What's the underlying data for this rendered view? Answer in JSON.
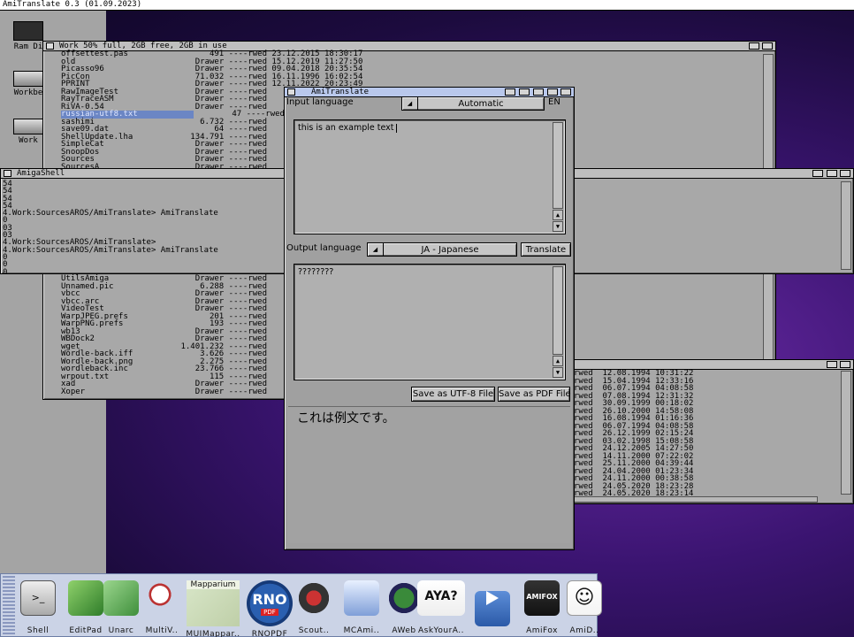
{
  "screen": {
    "title": "AmiTranslate 0.3 (01.09.2023)"
  },
  "desktop_icons": [
    "Ram Di",
    "Workbe",
    "Work"
  ],
  "work_window": {
    "title": "Work  50% full, 2GB free, 2GB in use",
    "files_top": [
      [
        "offsettest.pas",
        "491",
        "----rwed",
        "23.12.2015",
        "18:30:17"
      ],
      [
        "old",
        "Drawer",
        "----rwed",
        "15.12.2019",
        "11:27:50"
      ],
      [
        "Picasso96",
        "Drawer",
        "----rwed",
        "09.04.2018",
        "20:35:54"
      ],
      [
        "PicCon",
        "71.032",
        "----rwed",
        "16.11.1996",
        "16:02:54"
      ],
      [
        "PPRINT",
        "Drawer",
        "----rwed",
        "12.11.2022",
        "20:23:49"
      ],
      [
        "RawImageTest",
        "Drawer",
        "----rwed",
        "",
        ""
      ],
      [
        "RayTraceASM",
        "Drawer",
        "----rwed",
        "",
        ""
      ],
      [
        "RiVA-0.54",
        "Drawer",
        "----rwed",
        "",
        ""
      ],
      [
        "russian-utf8.txt",
        "47",
        "----rwed",
        "",
        ""
      ],
      [
        "sashimi",
        "6.732",
        "----rwed",
        "",
        ""
      ],
      [
        "save09.dat",
        "64",
        "----rwed",
        "",
        ""
      ],
      [
        "ShellUpdate.lha",
        "134.791",
        "----rwed",
        "",
        ""
      ],
      [
        "SimpleCat",
        "Drawer",
        "----rwed",
        "",
        ""
      ],
      [
        "SnoopDos",
        "Drawer",
        "----rwed",
        "",
        ""
      ],
      [
        "Sources",
        "Drawer",
        "----rwed",
        "",
        ""
      ],
      [
        "SourcesA",
        "Drawer",
        "----rwed",
        "",
        ""
      ]
    ],
    "files_bottom": [
      [
        "UtilsAmiga",
        "Drawer",
        "----rwed"
      ],
      [
        "Unnamed.pic",
        "6.288",
        "----rwed"
      ],
      [
        "vbcc",
        "Drawer",
        "----rwed"
      ],
      [
        "vbcc.arc",
        "Drawer",
        "----rwed"
      ],
      [
        "VideoTest",
        "Drawer",
        "----rwed"
      ],
      [
        "WarpJPEG.prefs",
        "201",
        "----rwed"
      ],
      [
        "WarpPNG.prefs",
        "193",
        "----rwed"
      ],
      [
        "wb13",
        "Drawer",
        "----rwed"
      ],
      [
        "WBDock2",
        "Drawer",
        "----rwed"
      ],
      [
        "wget",
        "1.401.232",
        "----rwed"
      ],
      [
        "Wordle-back.iff",
        "3.626",
        "----rwed"
      ],
      [
        "Wordle-back.png",
        "2.275",
        "----rwed"
      ],
      [
        "wordleback.inc",
        "23.766",
        "----rwed"
      ],
      [
        "wrpout.txt",
        "115",
        "----rwed"
      ],
      [
        "xad",
        "Drawer",
        "----rwed"
      ],
      [
        "Xoper",
        "Drawer",
        "----rwed"
      ]
    ]
  },
  "shell": {
    "title": "AmigaShell",
    "lines": [
      "54",
      "54",
      "54",
      "54",
      "4.Work:SourcesAROS/AmiTranslate> AmiTranslate",
      "0",
      "03",
      "03",
      "4.Work:SourcesAROS/AmiTranslate>",
      "4.Work:SourcesAROS/AmiTranslate> AmiTranslate",
      "0",
      "0",
      "0"
    ]
  },
  "right_window": {
    "lines": [
      [
        "rwed",
        "12.08.1994",
        "10:31:22"
      ],
      [
        "rwed",
        "15.04.1994",
        "12:33:16"
      ],
      [
        "rwed",
        "06.07.1994",
        "04:08:58"
      ],
      [
        "rwed",
        "07.08.1994",
        "12:31:32"
      ],
      [
        "rwed",
        "30.09.1999",
        "00:18:02"
      ],
      [
        "rwed",
        "26.10.2000",
        "14:58:08"
      ],
      [
        "rwed",
        "16.08.1994",
        "01:16:36"
      ],
      [
        "rwed",
        "06.07.1994",
        "04:08:58"
      ],
      [
        "rwed",
        "26.12.1999",
        "02:15:24"
      ],
      [
        "rwed",
        "03.02.1998",
        "15:08:58"
      ],
      [
        "rwed",
        "24.12.2005",
        "14:27:50"
      ],
      [
        "rwed",
        "14.11.2000",
        "07:22:02"
      ],
      [
        "rwed",
        "25.11.2000",
        "04:39:44"
      ],
      [
        "rwed",
        "24.04.2000",
        "01:23:34"
      ],
      [
        "rwed",
        "24.11.2000",
        "00:38:58"
      ],
      [
        "rwed",
        "24.05.2020",
        "18:23:28"
      ],
      [
        "rwed",
        "24.05.2020",
        "18:23:14"
      ]
    ]
  },
  "amitranslate": {
    "title": "AmiTranslate",
    "input_language_label": "Input language",
    "input_language_value": "Automatic",
    "detected_code": "EN",
    "input_text": "this is an example text",
    "output_language_label": "Output language",
    "output_language_value": "JA - Japanese",
    "translate_button": "Translate",
    "output_text": "????????",
    "save_utf8_button": "Save as UTF-8 File",
    "save_pdf_button": "Save as PDF File",
    "rendered_text": "これは例文です。"
  },
  "dock": {
    "items": [
      "Shell",
      "EditPad",
      "Unarc",
      "MultiV..",
      "MUIMappar..",
      "RNOPDF",
      "Scout..",
      "MCAmi..",
      "AWeb",
      "AskYourA..",
      "AmiTube",
      "AmiFox",
      "AmiD.."
    ],
    "mapparium_label": "Mapparium",
    "rno_label": "RNO",
    "rno_sub": "PDF",
    "aya_label": "AYA?",
    "amifox_label": "AMIFOX"
  }
}
